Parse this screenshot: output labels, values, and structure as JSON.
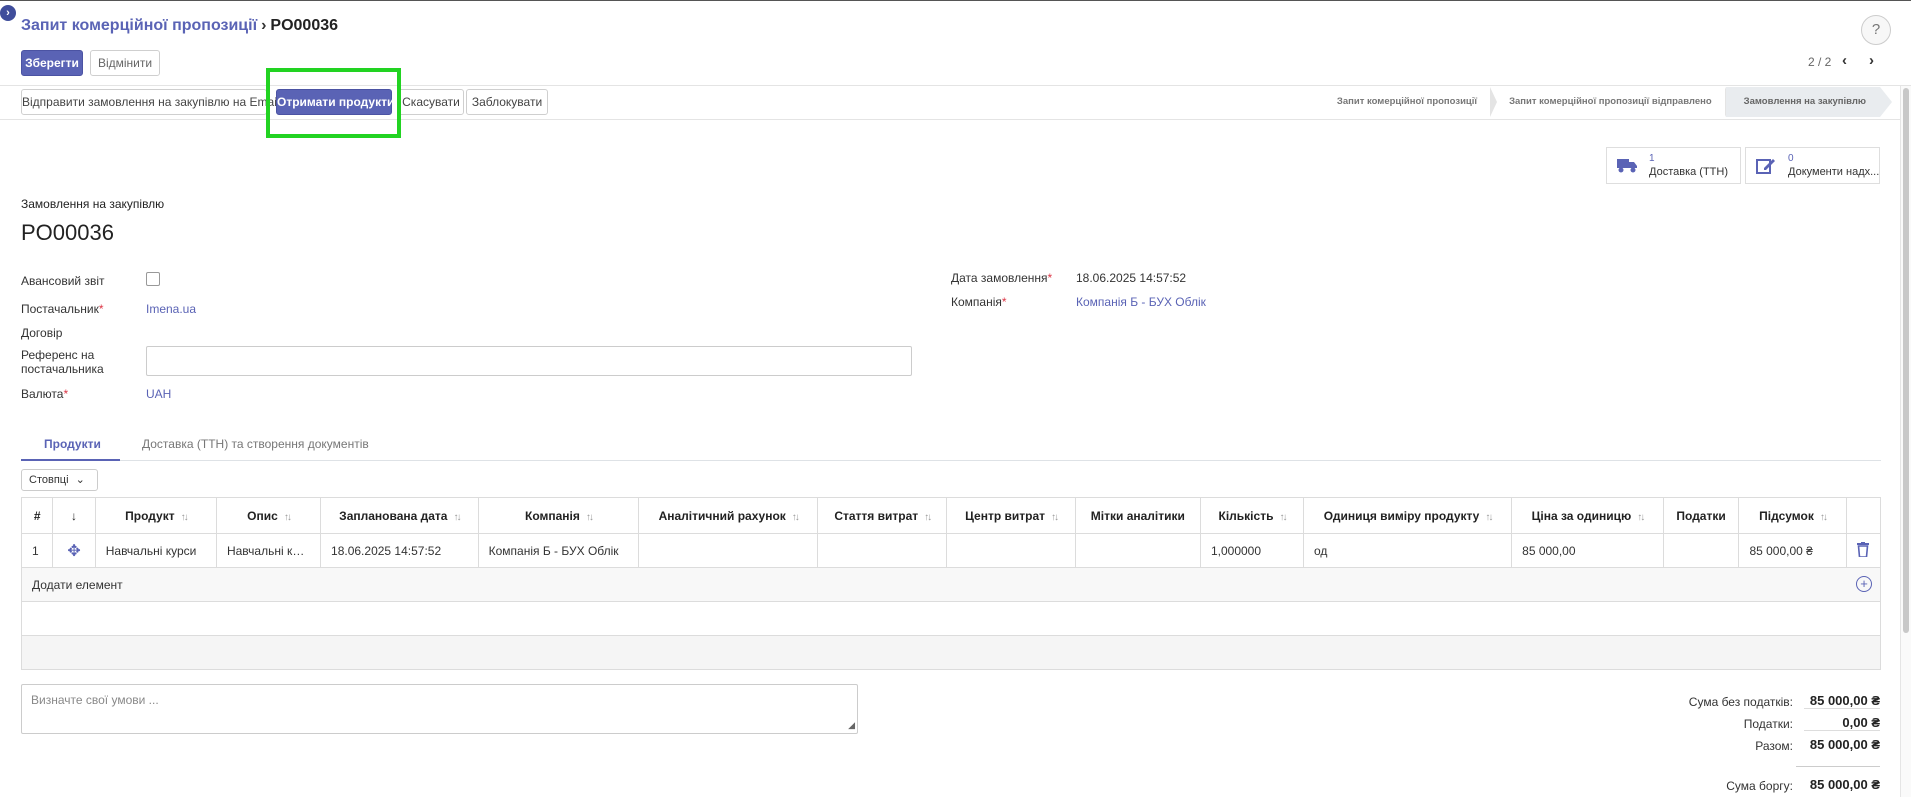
{
  "breadcrumb": {
    "parent": "Запит комерційної пропозиції",
    "current": "PO00036"
  },
  "control": {
    "save": "Зберегти",
    "discard": "Відмінити",
    "help": "?"
  },
  "pager": {
    "value": "2 / 2",
    "prev": "‹",
    "next": "›"
  },
  "actions": {
    "send_email": "Відправити замовлення на закупівлю на Email",
    "receive": "Отримати продукти",
    "cancel": "Скасувати",
    "lock": "Заблокувати"
  },
  "stages": [
    "Запит комерційної пропозиції",
    "Запит комерційної пропозиції відправлено",
    "Замовлення на закупівлю"
  ],
  "smart_buttons": [
    {
      "count": "1",
      "label": "Доставка (ТТН)",
      "icon": "truck-icon"
    },
    {
      "count": "0",
      "label": "Документи надх...",
      "icon": "edit-icon"
    }
  ],
  "header": {
    "doc_type": "Замовлення на закупівлю",
    "number": "PO00036"
  },
  "fields": {
    "advance_report": "Авансовий звіт",
    "vendor": "Постачальник",
    "vendor_value": "Imena.ua",
    "contract": "Договір",
    "vendor_ref": "Референс на постачальника",
    "currency": "Валюта",
    "currency_value": "UAH",
    "order_date": "Дата замовлення",
    "order_date_value": "18.06.2025 14:57:52",
    "company": "Компанія",
    "company_value": "Компанія Б - БУХ Облік",
    "required_mark": "*"
  },
  "tabs": [
    "Продукти",
    "Доставка (ТТН) та створення документів"
  ],
  "columns_button": "Стовпці",
  "table": {
    "headers": [
      "#",
      "↓",
      "Продукт",
      "Опис",
      "Запланована дата",
      "Компанія",
      "Аналітичний рахунок",
      "Стаття витрат",
      "Центр витрат",
      "Мітки аналітики",
      "Кількість",
      "Одиниця виміру продукту",
      "Ціна за одиницю",
      "Податки",
      "Підсумок"
    ],
    "rows": [
      [
        "1",
        "✥",
        "Навчальні курси",
        "Навчальні курси",
        "18.06.2025 14:57:52",
        "Компанія Б - БУХ Облік",
        "",
        "",
        "",
        "",
        "1,000000",
        "од",
        "85 000,00",
        "",
        "85 000,00 ₴"
      ]
    ],
    "add_line": "Додати елемент"
  },
  "terms_placeholder": "Визначте свої умови ...",
  "totals": {
    "untaxed_label": "Сума без податків:",
    "untaxed": "85 000,00 ₴",
    "taxes_label": "Податки:",
    "taxes": "0,00 ₴",
    "total_label": "Разом:",
    "total": "85 000,00 ₴",
    "due_label": "Сума боргу:",
    "due": "85 000,00 ₴"
  },
  "colors": {
    "accent": "#5a63b5",
    "highlight": "#22d322"
  }
}
